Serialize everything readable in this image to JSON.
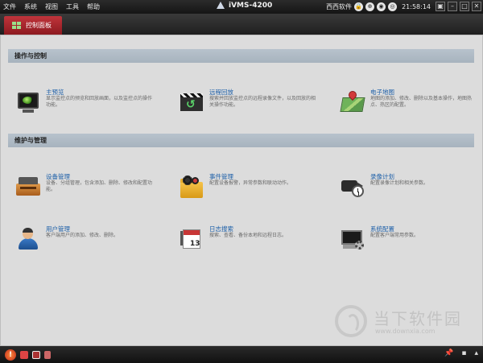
{
  "menu": {
    "items": [
      "文件",
      "系统",
      "视图",
      "工具",
      "帮助"
    ]
  },
  "app": {
    "title": "iVMS-4200"
  },
  "topbar_right": {
    "user_label": "西西软件",
    "time": "21:58:14",
    "window_controls": [
      "restore",
      "minimize",
      "maximize",
      "close"
    ]
  },
  "tabs": [
    {
      "label": "控制面板",
      "active": true
    }
  ],
  "sections": [
    {
      "header": "操作与控制",
      "items": [
        {
          "title": "主预览",
          "desc": "显示监控点的预览和回放画面，以及监控点的操作功能。",
          "icon": "monitor-icon"
        },
        {
          "title": "远程回放",
          "desc": "搜索并回放监控点的远程录像文件，以及回放的相关操作功能。",
          "icon": "playback-icon"
        },
        {
          "title": "电子地图",
          "desc": "地图的添加、修改、删除以及基本操作，地图热点、热区的配置。",
          "icon": "map-icon"
        }
      ]
    },
    {
      "header": "维护与管理",
      "items": [
        {
          "title": "设备管理",
          "desc": "设备、分组管理，包含添加、删除、修改和配置功能。",
          "icon": "device-icon"
        },
        {
          "title": "事件管理",
          "desc": "配置设备报警，异常参数和联动动作。",
          "icon": "event-icon"
        },
        {
          "title": "录像计划",
          "desc": "配置录像计划和相关参数。",
          "icon": "record-schedule-icon"
        },
        {
          "title": "用户管理",
          "desc": "客户端用户的添加、修改、删除。",
          "icon": "user-icon"
        },
        {
          "title": "日志搜索",
          "desc": "搜索、查看、备份本地和远程日志。",
          "icon": "log-icon"
        },
        {
          "title": "系统配置",
          "desc": "配置客户端常用参数。",
          "icon": "system-config-icon"
        }
      ]
    }
  ],
  "calendar_number": "13",
  "watermark": {
    "text": "当下软件园",
    "url": "www.downxia.com"
  },
  "colors": {
    "accent_tab": "#b0262d",
    "section_header": "#afbac5",
    "link_title": "#1d5fa8"
  }
}
